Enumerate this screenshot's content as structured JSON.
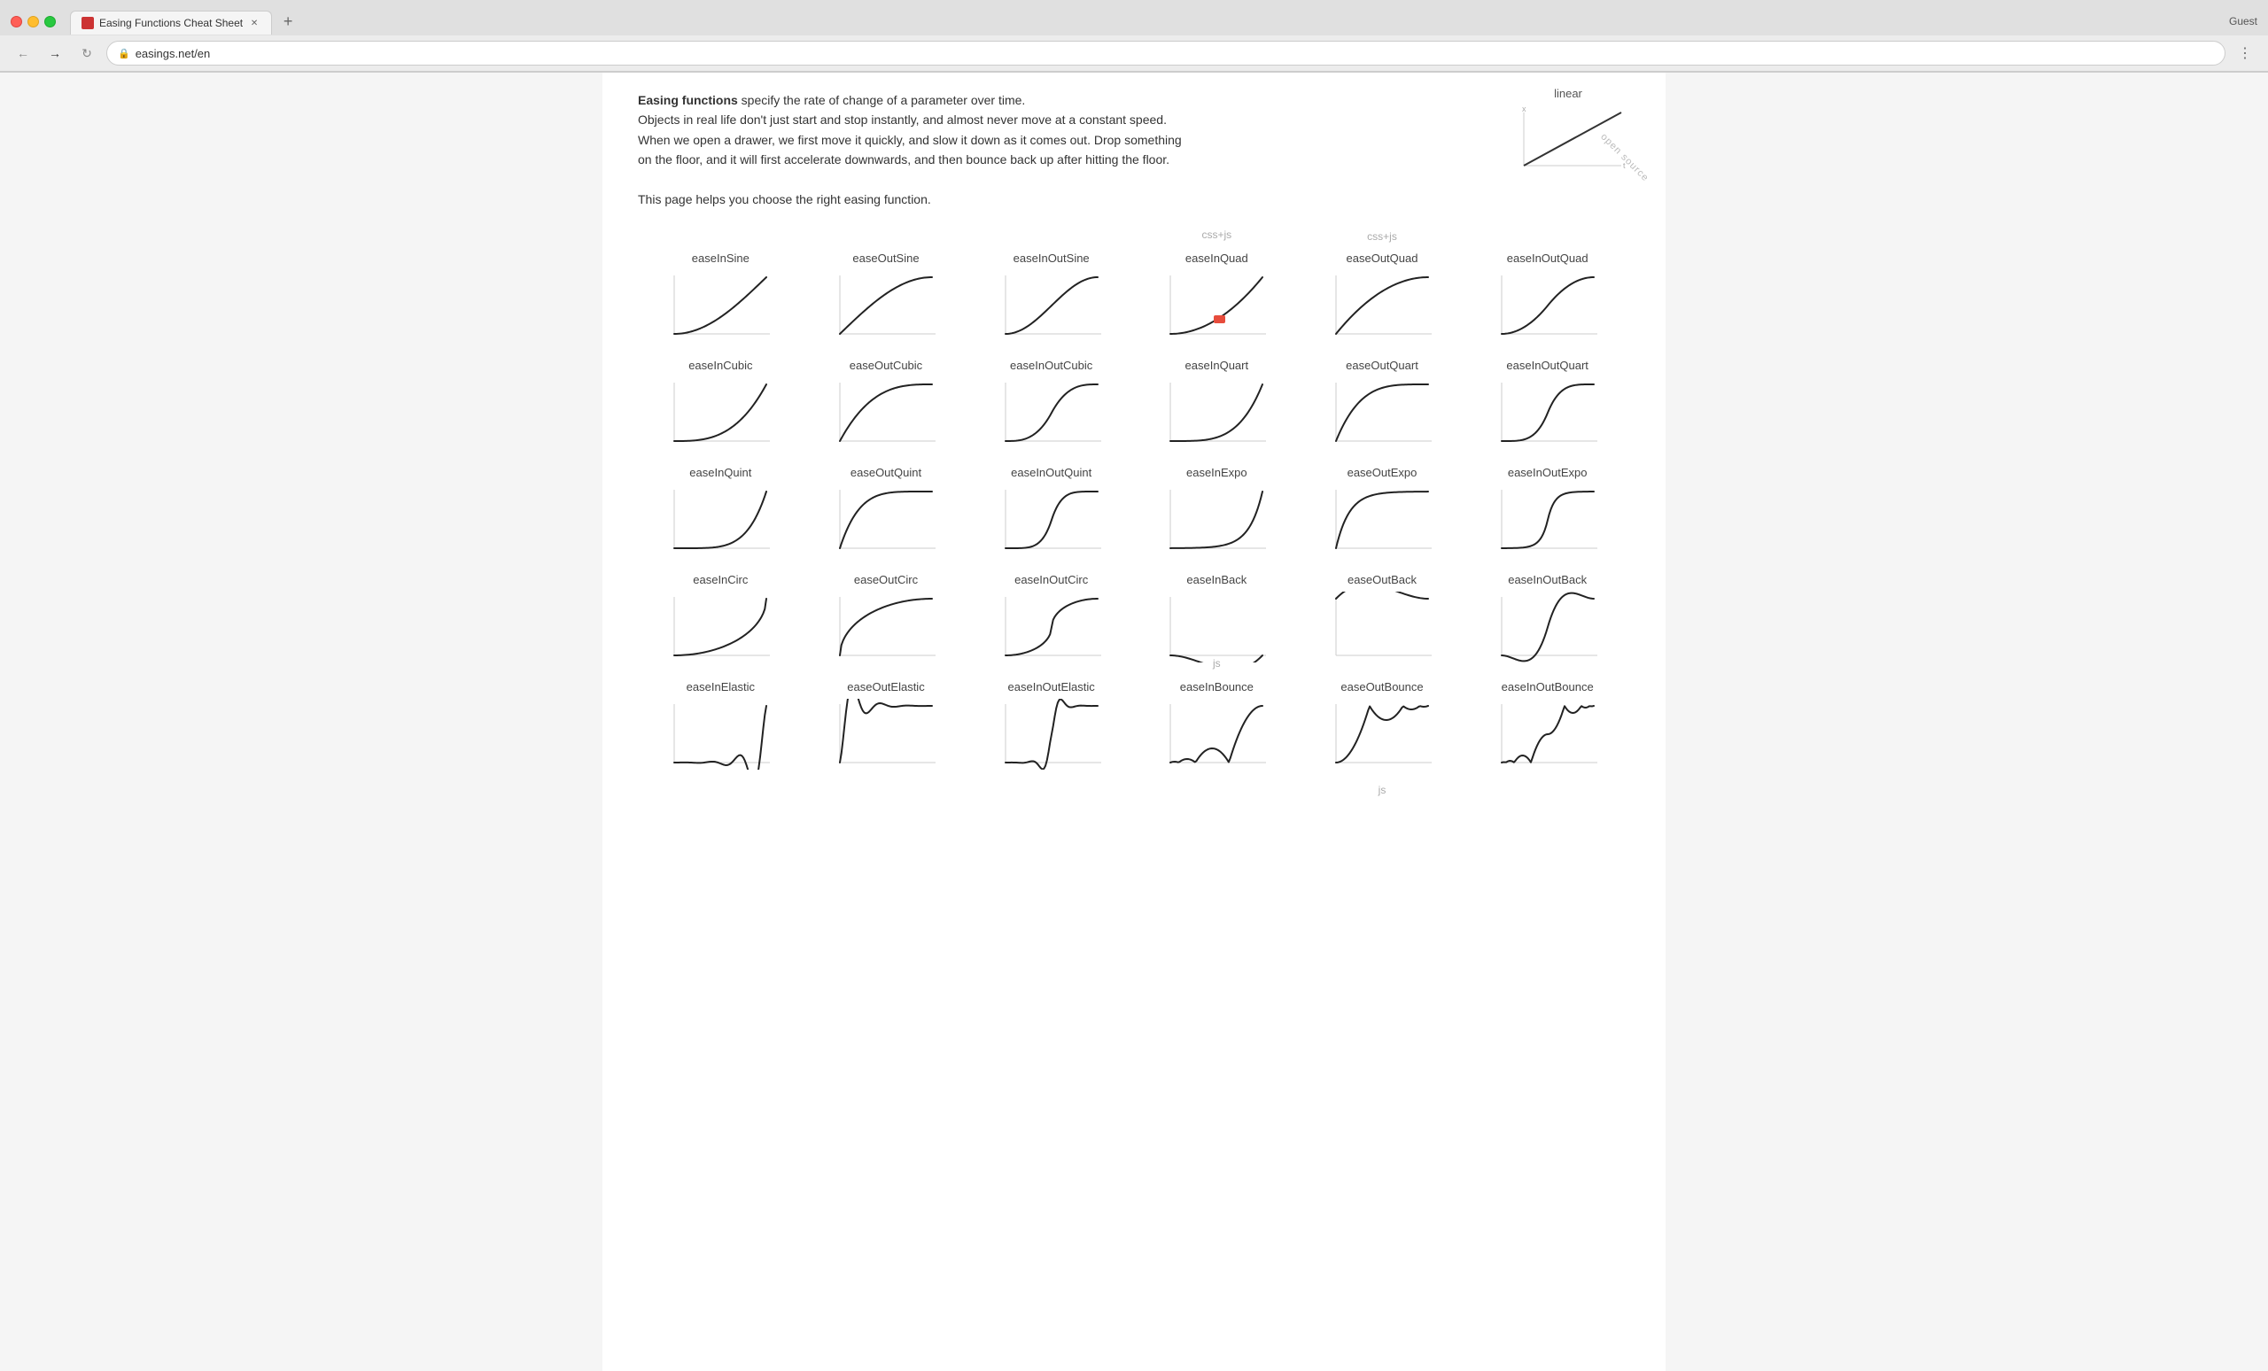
{
  "browser": {
    "tab_title": "Easing Functions Cheat Sheet",
    "url": "easings.net/en",
    "guest_label": "Guest"
  },
  "page": {
    "intro_bold": "Easing functions",
    "intro_text": " specify the rate of change of a parameter over time.",
    "intro_p2": "Objects in real life don't just start and stop instantly, and almost never move at a constant speed.",
    "intro_p3": "When we open a drawer, we first move it quickly, and slow it down as it comes out. Drop something",
    "intro_p4": "on the floor, and it will first accelerate downwards, and then bounce back up after hitting the floor.",
    "intro_p5": "This page helps you choose the right easing function.",
    "linear_label": "linear",
    "css_js_label": "css+js",
    "js_label": "js",
    "open_source": "open source"
  },
  "easings": {
    "rows": [
      {
        "cells": [
          {
            "name": "easeInSine",
            "type": "easeInSine"
          },
          {
            "name": "easeOutSine",
            "type": "easeOutSine"
          },
          {
            "name": "easeInOutSine",
            "type": "easeInOutSine"
          },
          {
            "name": "easeInQuad",
            "type": "easeInQuad",
            "highlighted": true
          },
          {
            "name": "easeOutQuad",
            "type": "easeOutQuad"
          },
          {
            "name": "easeInOutQuad",
            "type": "easeInOutQuad"
          }
        ]
      },
      {
        "cells": [
          {
            "name": "easeInCubic",
            "type": "easeInCubic"
          },
          {
            "name": "easeOutCubic",
            "type": "easeOutCubic"
          },
          {
            "name": "easeInOutCubic",
            "type": "easeInOutCubic"
          },
          {
            "name": "easeInQuart",
            "type": "easeInQuart"
          },
          {
            "name": "easeOutQuart",
            "type": "easeOutQuart"
          },
          {
            "name": "easeInOutQuart",
            "type": "easeInOutQuart"
          }
        ]
      },
      {
        "cells": [
          {
            "name": "easeInQuint",
            "type": "easeInQuint"
          },
          {
            "name": "easeOutQuint",
            "type": "easeOutQuint"
          },
          {
            "name": "easeInOutQuint",
            "type": "easeInOutQuint"
          },
          {
            "name": "easeInExpo",
            "type": "easeInExpo"
          },
          {
            "name": "easeOutExpo",
            "type": "easeOutExpo"
          },
          {
            "name": "easeInOutExpo",
            "type": "easeInOutExpo"
          }
        ]
      },
      {
        "cells": [
          {
            "name": "easeInCirc",
            "type": "easeInCirc"
          },
          {
            "name": "easeOutCirc",
            "type": "easeOutCirc"
          },
          {
            "name": "easeInOutCirc",
            "type": "easeInOutCirc"
          },
          {
            "name": "easeInBack",
            "type": "easeInBack"
          },
          {
            "name": "easeOutBack",
            "type": "easeOutBack"
          },
          {
            "name": "easeInOutBack",
            "type": "easeInOutBack"
          }
        ]
      },
      {
        "cells": [
          {
            "name": "easeInElastic",
            "type": "easeInElastic",
            "partial": true
          },
          {
            "name": "easeOutElastic",
            "type": "easeOutElastic",
            "partial": true
          },
          {
            "name": "easeInOutElastic",
            "type": "easeInOutElastic",
            "partial": true
          },
          {
            "name": "easeInBounce",
            "type": "easeInBounce",
            "partial": true
          },
          {
            "name": "easeOutBounce",
            "type": "easeOutBounce",
            "partial": true
          },
          {
            "name": "easeInOutBounce",
            "type": "easeInOutBounce",
            "partial": true
          }
        ]
      }
    ]
  }
}
